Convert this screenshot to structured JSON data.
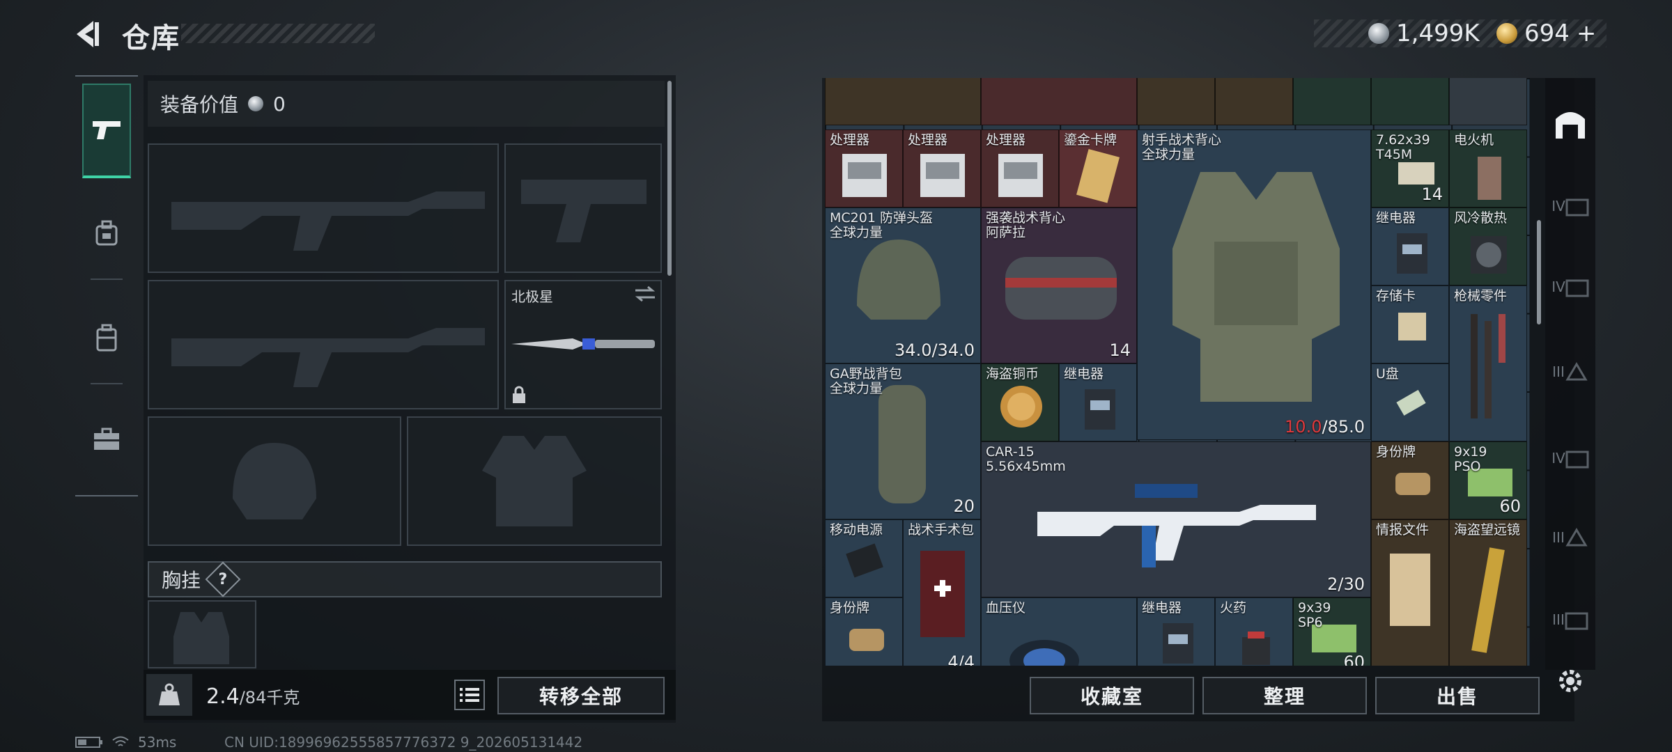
{
  "header": {
    "title": "仓库"
  },
  "currency": {
    "silver": "1,499K",
    "gold": "694",
    "gold_add": "+"
  },
  "equipment": {
    "value_label": "装备价值",
    "value": "0",
    "melee_name": "北极星",
    "chest_rig_label": "胸挂",
    "chest_rig_help": "?"
  },
  "footer": {
    "weight_value": "2.4",
    "weight_max": "/84千克",
    "transfer_all": "转移全部"
  },
  "status": {
    "ping": "53ms",
    "uid": "CN UID:18996962555857776372 9_202605131442"
  },
  "inventory": {
    "items": [
      {
        "name": "处理器",
        "count": ""
      },
      {
        "name": "处理器",
        "count": ""
      },
      {
        "name": "处理器",
        "count": ""
      },
      {
        "name": "鎏金卡牌",
        "count": ""
      },
      {
        "name": "射手战术背心\n全球力量",
        "count": ""
      },
      {
        "name": "7.62x39\nT45M",
        "count": "14"
      },
      {
        "name": "电火机",
        "count": ""
      },
      {
        "name": "MC201 防弹头盔\n全球力量",
        "count": "34.0/34.0"
      },
      {
        "name": "强袭战术背心\n阿萨拉",
        "count": "14"
      },
      {
        "name": "继电器",
        "count": ""
      },
      {
        "name": "风冷散热",
        "count": ""
      },
      {
        "name": "存储卡",
        "count": ""
      },
      {
        "name": "枪械零件",
        "count": ""
      },
      {
        "name": "GA野战背包\n全球力量",
        "count": "20"
      },
      {
        "name": "海盗铜币",
        "count": ""
      },
      {
        "name": "继电器",
        "count": ""
      },
      {
        "name": "U盘",
        "count": ""
      },
      {
        "name": "CAR-15\n5.56x45mm",
        "count": "2/30"
      },
      {
        "name": "身份牌",
        "count": ""
      },
      {
        "name": "9x19\nPSO",
        "count": "60"
      },
      {
        "name": "移动电源",
        "count": ""
      },
      {
        "name": "战术手术包",
        "count": "4/4"
      },
      {
        "name": "情报文件",
        "count": ""
      },
      {
        "name": "海盗望远镜",
        "count": ""
      },
      {
        "name": "身份牌",
        "count": ""
      },
      {
        "name": "血压仪",
        "count": ""
      },
      {
        "name": "继电器",
        "count": ""
      },
      {
        "name": "火药",
        "count": ""
      },
      {
        "name": "9x39\nSP6",
        "count": "60"
      }
    ],
    "vest_durability_current": "10.0",
    "vest_durability_max": "/85.0"
  },
  "right_rail": {
    "labels": [
      "IV",
      "IV",
      "III",
      "IV",
      "III",
      "III"
    ]
  },
  "actions": {
    "collection": "收藏室",
    "sort": "整理",
    "sell": "出售"
  },
  "colors": {
    "accent": "#3fd3a6",
    "damage_red": "#e0393c"
  }
}
